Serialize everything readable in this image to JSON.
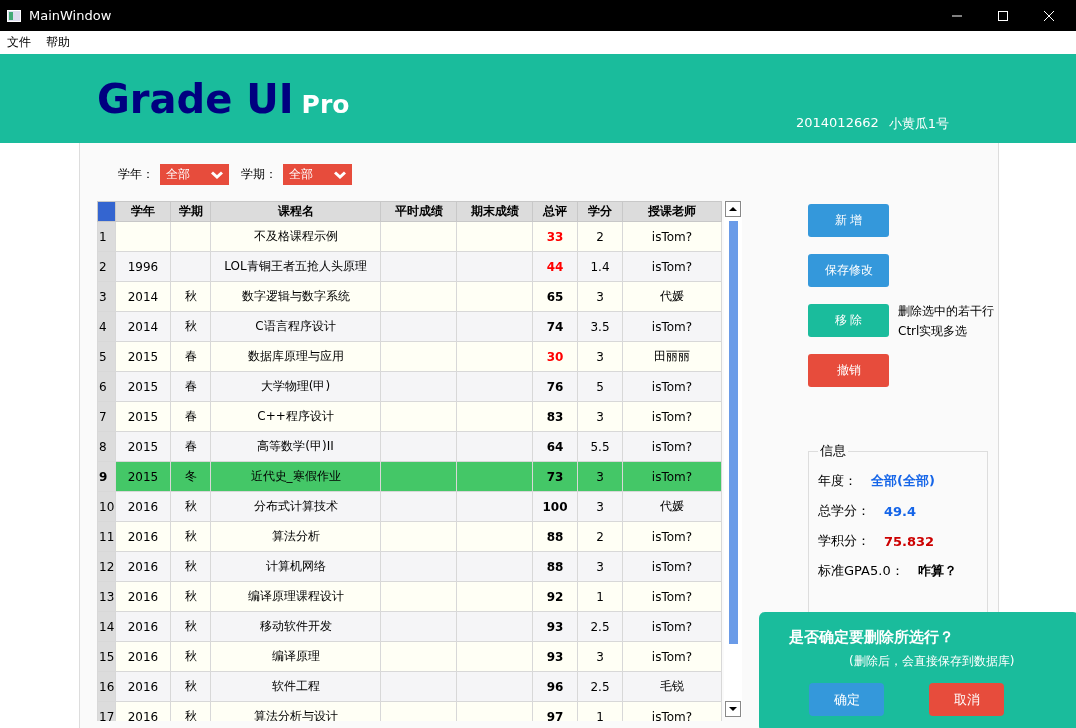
{
  "window": {
    "title": "MainWindow"
  },
  "menu": [
    "文件",
    "帮助"
  ],
  "header": {
    "logo": "Grade UI",
    "logo_suffix": "Pro",
    "student_id": "2014012662",
    "student_name": "小黄瓜1号"
  },
  "filters": [
    {
      "label": "学年：",
      "value": "全部"
    },
    {
      "label": "学期：",
      "value": "全部"
    }
  ],
  "table": {
    "columns": [
      "学年",
      "学期",
      "课程名",
      "平时成绩",
      "期末成绩",
      "总评",
      "学分",
      "授课老师"
    ],
    "rows": [
      {
        "no": "1",
        "course": "不及格课程示例",
        "total": "33",
        "credit": "2",
        "teacher": "isTom?",
        "failing": true,
        "selected": false
      },
      {
        "no": "2",
        "year": "1996",
        "course": "LOL青铜王者五抢人头原理",
        "total": "44",
        "credit": "1.4",
        "teacher": "isTom?",
        "failing": true,
        "selected": false
      },
      {
        "no": "3",
        "year": "2014",
        "term": "秋",
        "course": "数字逻辑与数字系统",
        "total": "65",
        "credit": "3",
        "teacher": "代媛",
        "failing": false,
        "selected": false
      },
      {
        "no": "4",
        "year": "2014",
        "term": "秋",
        "course": "C语言程序设计",
        "total": "74",
        "credit": "3.5",
        "teacher": "isTom?",
        "failing": false,
        "selected": false
      },
      {
        "no": "5",
        "year": "2015",
        "term": "春",
        "course": "数据库原理与应用",
        "total": "30",
        "credit": "3",
        "teacher": "田丽丽",
        "failing": true,
        "selected": false
      },
      {
        "no": "6",
        "year": "2015",
        "term": "春",
        "course": "大学物理(甲)",
        "total": "76",
        "credit": "5",
        "teacher": "isTom?",
        "failing": false,
        "selected": false
      },
      {
        "no": "7",
        "year": "2015",
        "term": "春",
        "course": "C++程序设计",
        "total": "83",
        "credit": "3",
        "teacher": "isTom?",
        "failing": false,
        "selected": false
      },
      {
        "no": "8",
        "year": "2015",
        "term": "春",
        "course": "高等数学(甲)II",
        "total": "64",
        "credit": "5.5",
        "teacher": "isTom?",
        "failing": false,
        "selected": false
      },
      {
        "no": "9",
        "year": "2015",
        "term": "冬",
        "course": "近代史_寒假作业",
        "total": "73",
        "credit": "3",
        "teacher": "isTom?",
        "failing": false,
        "selected": true
      },
      {
        "no": "10",
        "year": "2016",
        "term": "秋",
        "course": "分布式计算技术",
        "total": "100",
        "credit": "3",
        "teacher": "代媛",
        "failing": false,
        "selected": false
      },
      {
        "no": "11",
        "year": "2016",
        "term": "秋",
        "course": "算法分析",
        "total": "88",
        "credit": "2",
        "teacher": "isTom?",
        "failing": false,
        "selected": false
      },
      {
        "no": "12",
        "year": "2016",
        "term": "秋",
        "course": "计算机网络",
        "total": "88",
        "credit": "3",
        "teacher": "isTom?",
        "failing": false,
        "selected": false
      },
      {
        "no": "13",
        "year": "2016",
        "term": "秋",
        "course": "编译原理课程设计",
        "total": "92",
        "credit": "1",
        "teacher": "isTom?",
        "failing": false,
        "selected": false
      },
      {
        "no": "14",
        "year": "2016",
        "term": "秋",
        "course": "移动软件开发",
        "total": "93",
        "credit": "2.5",
        "teacher": "isTom?",
        "failing": false,
        "selected": false
      },
      {
        "no": "15",
        "year": "2016",
        "term": "秋",
        "course": "编译原理",
        "total": "93",
        "credit": "3",
        "teacher": "isTom?",
        "failing": false,
        "selected": false
      },
      {
        "no": "16",
        "year": "2016",
        "term": "秋",
        "course": "软件工程",
        "total": "96",
        "credit": "2.5",
        "teacher": "毛锐",
        "failing": false,
        "selected": false
      },
      {
        "no": "17",
        "year": "2016",
        "term": "秋",
        "course": "算法分析与设计",
        "total": "97",
        "credit": "1",
        "teacher": "isTom?",
        "failing": false,
        "selected": false
      }
    ]
  },
  "actions": [
    {
      "label": "新 增",
      "kind": "primary"
    },
    {
      "label": "保存修改",
      "kind": "primary"
    },
    {
      "label": "移 除",
      "kind": "teal",
      "hint": [
        "删除选中的若干行",
        "Ctrl实现多选"
      ]
    },
    {
      "label": "撤销",
      "kind": "danger"
    }
  ],
  "info": {
    "title": "信息",
    "items": [
      {
        "label": "年度：",
        "value": "全部(全部)",
        "color": "#1565e8"
      },
      {
        "label": "总学分：",
        "value": "49.4",
        "color": "#1565e8"
      },
      {
        "label": "学积分：",
        "value": "75.832",
        "color": "#cc0000"
      },
      {
        "label": "标准GPA5.0：",
        "value": "咋算？",
        "color": "#000000"
      }
    ]
  },
  "dialog": {
    "title": "是否确定要删除所选行？",
    "message": "(删除后，会直接保存到数据库)",
    "buttons": [
      {
        "label": "确定",
        "kind": "primary"
      },
      {
        "label": "取消",
        "kind": "danger"
      }
    ]
  }
}
